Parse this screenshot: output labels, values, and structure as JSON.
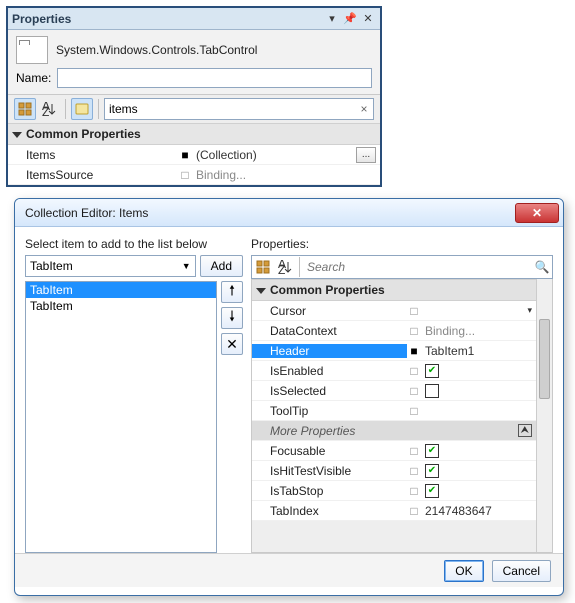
{
  "properties_panel": {
    "title": "Properties",
    "object_type": "System.Windows.Controls.TabControl",
    "name_label": "Name:",
    "name_value": "",
    "search_value": "items",
    "sections": {
      "common": {
        "header": "Common Properties",
        "items": {
          "label": "Items",
          "marker": "■",
          "value": "(Collection)",
          "button": "..."
        },
        "itemssource": {
          "label": "ItemsSource",
          "marker": "□",
          "value": "Binding..."
        }
      }
    }
  },
  "dialog": {
    "title": "Collection Editor: Items",
    "left": {
      "instruction": "Select item to add to the list below",
      "combo_value": "TabItem",
      "add_label": "Add",
      "list": [
        "TabItem",
        "TabItem"
      ],
      "selected_index": 0
    },
    "right": {
      "header": "Properties:",
      "search_placeholder": "Search",
      "sections": {
        "common_header": "Common Properties",
        "more_header": "More Properties",
        "rows": {
          "cursor": {
            "label": "Cursor",
            "marker": "□",
            "value": ""
          },
          "datacontext": {
            "label": "DataContext",
            "marker": "□",
            "value": "Binding..."
          },
          "header": {
            "label": "Header",
            "marker": "■",
            "value": "TabItem1"
          },
          "isenabled": {
            "label": "IsEnabled",
            "marker": "□",
            "checked": true
          },
          "isselected": {
            "label": "IsSelected",
            "marker": "□",
            "checked": false
          },
          "tooltip": {
            "label": "ToolTip",
            "marker": "□",
            "value": ""
          },
          "focusable": {
            "label": "Focusable",
            "marker": "□",
            "checked": true
          },
          "ishittest": {
            "label": "IsHitTestVisible",
            "marker": "□",
            "checked": true
          },
          "istabstop": {
            "label": "IsTabStop",
            "marker": "□",
            "checked": true
          },
          "tabindex": {
            "label": "TabIndex",
            "marker": "□",
            "value": "2147483647"
          }
        }
      }
    },
    "footer": {
      "ok": "OK",
      "cancel": "Cancel"
    }
  }
}
